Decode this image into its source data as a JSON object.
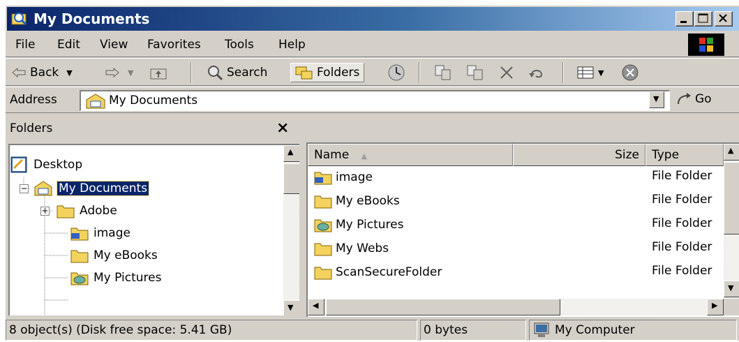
{
  "window": {
    "title": "My Documents"
  },
  "menu": [
    "File",
    "Edit",
    "View",
    "Favorites",
    "Tools",
    "Help"
  ],
  "toolbar": {
    "back_label": "Back",
    "search_label": "Search",
    "folders_label": "Folders"
  },
  "address": {
    "label": "Address",
    "value": "My Documents",
    "go_label": "Go"
  },
  "folders_pane": {
    "title": "Folders",
    "close_glyph": "×",
    "tree": [
      {
        "label": "Desktop"
      },
      {
        "label": "My Documents"
      },
      {
        "label": "Adobe"
      },
      {
        "label": "image"
      },
      {
        "label": "My eBooks"
      },
      {
        "label": "My Pictures"
      }
    ]
  },
  "file_list": {
    "columns": {
      "name": "Name",
      "size": "Size",
      "type": "Type"
    },
    "rows": [
      {
        "name": "image",
        "size": "",
        "type": "File Folder",
        "icon": "special-folder-icon"
      },
      {
        "name": "My eBooks",
        "size": "",
        "type": "File Folder",
        "icon": "folder-icon"
      },
      {
        "name": "My Pictures",
        "size": "",
        "type": "File Folder",
        "icon": "pictures-folder-icon"
      },
      {
        "name": "My Webs",
        "size": "",
        "type": "File Folder",
        "icon": "folder-icon"
      },
      {
        "name": "ScanSecureFolder",
        "size": "",
        "type": "File Folder",
        "icon": "folder-icon"
      }
    ]
  },
  "status": {
    "objects": "8 object(s) (Disk free space: 5.41 GB)",
    "size": "0 bytes",
    "zone": "My Computer"
  },
  "colors": {
    "titlebar_start": "#0a246a",
    "titlebar_end": "#a6caf0",
    "selection": "#0a246a",
    "face": "#d4d0c8",
    "folder": "#f3d35e"
  }
}
